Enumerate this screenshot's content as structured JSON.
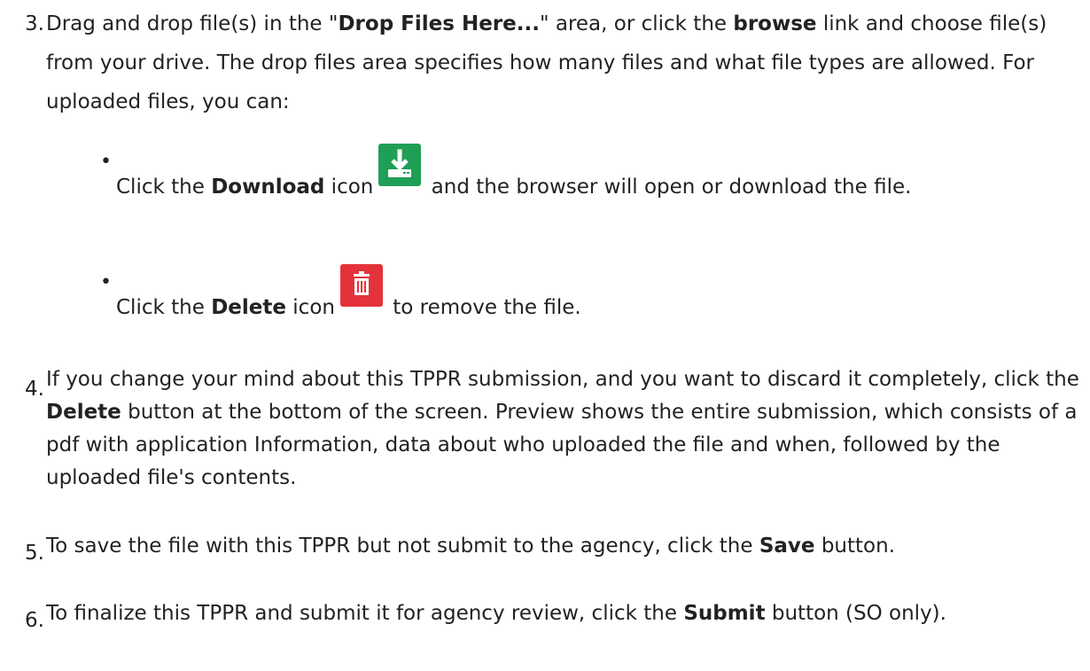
{
  "steps": [
    {
      "number": "3.",
      "intro_1": "Drag and drop file(s) in the \"",
      "bold_drop": "Drop Files Here...",
      "intro_2": "\" area, or click the ",
      "bold_browse": "browse",
      "intro_3": " link and choose file(s) from your drive. The drop files area specifies how many files and what file types are allowed. For uploaded files, you can:",
      "bullets": [
        {
          "bullet": "•",
          "pre": "Click the ",
          "bold": "Download",
          "mid": " icon",
          "icon": "download-icon",
          "post": " and the browser will open or download the file."
        },
        {
          "bullet": "•",
          "pre": "Click the ",
          "bold": "Delete",
          "mid": " icon",
          "icon": "trash-icon",
          "post": " to remove the file."
        }
      ]
    },
    {
      "number": "4.",
      "pre": "If you change your mind about this TPPR submission, and you want to discard it completely, click the ",
      "bold": "Delete",
      "post": " button at the bottom of the screen. Preview shows the entire submission, which consists of a pdf with application Information, data about who uploaded the file and when, followed by the uploaded file's contents."
    },
    {
      "number": "5.",
      "pre": "To save the file with this TPPR but not submit to the agency, click the ",
      "bold": "Save",
      "post": " button."
    },
    {
      "number": "6.",
      "pre": "To finalize this TPPR and submit it for agency review, click the ",
      "bold": "Submit",
      "post": " button (SO only)."
    }
  ],
  "colors": {
    "download_icon_bg": "#1f9e56",
    "delete_icon_bg": "#e4323a",
    "text": "#222222"
  }
}
